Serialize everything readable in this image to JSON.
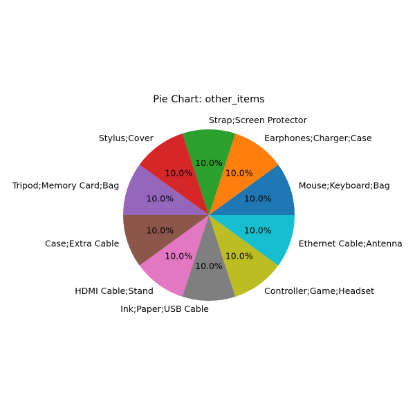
{
  "chart_data": {
    "type": "pie",
    "title": "Pie Chart: other_items",
    "start_angle_deg": 0,
    "direction": "counterclockwise",
    "slices": [
      {
        "label": "Mouse;Keyboard;Bag",
        "value": 10.0,
        "pct_label": "10.0%",
        "color": "#1f77b4"
      },
      {
        "label": "Earphones;Charger;Case",
        "value": 10.0,
        "pct_label": "10.0%",
        "color": "#ff7f0e"
      },
      {
        "label": "Strap;Screen Protector",
        "value": 10.0,
        "pct_label": "10.0%",
        "color": "#2ca02c"
      },
      {
        "label": "Stylus;Cover",
        "value": 10.0,
        "pct_label": "10.0%",
        "color": "#d62728"
      },
      {
        "label": "Tripod;Memory Card;Bag",
        "value": 10.0,
        "pct_label": "10.0%",
        "color": "#9467bd"
      },
      {
        "label": "Case;Extra Cable",
        "value": 10.0,
        "pct_label": "10.0%",
        "color": "#8c564b"
      },
      {
        "label": "HDMI Cable;Stand",
        "value": 10.0,
        "pct_label": "10.0%",
        "color": "#e377c2"
      },
      {
        "label": "Ink;Paper;USB Cable",
        "value": 10.0,
        "pct_label": "10.0%",
        "color": "#7f7f7f"
      },
      {
        "label": "Controller;Game;Headset",
        "value": 10.0,
        "pct_label": "10.0%",
        "color": "#bcbd22"
      },
      {
        "label": "Ethernet Cable;Antenna",
        "value": 10.0,
        "pct_label": "10.0%",
        "color": "#17becf"
      }
    ]
  }
}
